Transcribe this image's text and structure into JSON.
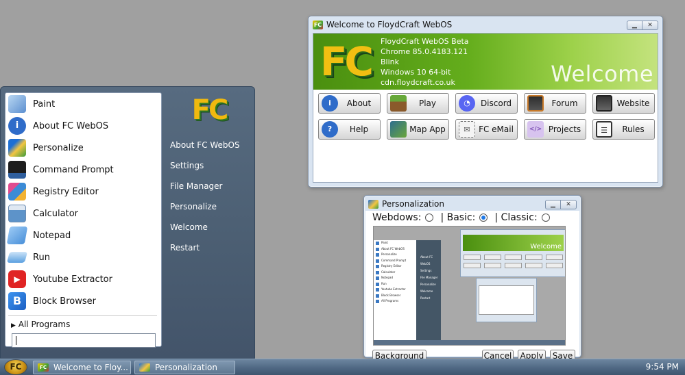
{
  "welcome_window": {
    "title": "Welcome to FloydCraft WebOS",
    "logo": "FC",
    "info": [
      "FloydCraft WebOS Beta",
      "Chrome 85.0.4183.121",
      "Blink",
      "Windows 10 64-bit",
      "cdn.floydcraft.co.uk"
    ],
    "welcome_text": "Welcome",
    "buttons": [
      {
        "label": "About",
        "icon": "info-icon",
        "color": "#2f6cc9"
      },
      {
        "label": "Play",
        "icon": "grass-block-icon",
        "color": "#5c8a2e"
      },
      {
        "label": "Discord",
        "icon": "discord-icon",
        "color": "#5865f2"
      },
      {
        "label": "Forum",
        "icon": "forum-icon",
        "color": "#2d2d2d"
      },
      {
        "label": "Website",
        "icon": "website-icon",
        "color": "#333333"
      },
      {
        "label": "Help",
        "icon": "help-icon",
        "color": "#2f6cc9"
      },
      {
        "label": "Map App",
        "icon": "map-icon",
        "color": "#2e6f8f"
      },
      {
        "label": "FC eMail",
        "icon": "email-icon",
        "color": "#777777"
      },
      {
        "label": "Projects",
        "icon": "projects-icon",
        "color": "#b38fd9"
      },
      {
        "label": "Rules",
        "icon": "rules-icon",
        "color": "#3a3a3a"
      }
    ]
  },
  "personalization_window": {
    "title": "Personalization",
    "modes": [
      {
        "label": "Webdows:",
        "selected": false
      },
      {
        "label": "| Basic:",
        "selected": true
      },
      {
        "label": "| Classic:",
        "selected": false
      }
    ],
    "preview": {
      "start_items": [
        "Paint",
        "About FC WebOS",
        "Personalize",
        "Command Prompt",
        "Registry Editor",
        "Calculator",
        "Notepad",
        "Run",
        "Youtube Extractor",
        "Block Browser",
        "All Programs"
      ],
      "right_items": [
        "About FC WebOS",
        "Settings",
        "File Manager",
        "Personalize",
        "Welcome",
        "Restart"
      ],
      "welcome_caption": "Welcome"
    },
    "buttons": {
      "background": "Background",
      "cancel": "Cancel",
      "apply": "Apply",
      "save": "Save"
    }
  },
  "start_menu": {
    "items": [
      {
        "label": "Paint",
        "icon": "paint-icon",
        "color": "#6aa0d8"
      },
      {
        "label": "About FC WebOS",
        "icon": "info-icon",
        "color": "#2f6cc9"
      },
      {
        "label": "Personalize",
        "icon": "personalize-icon",
        "color": "#2a7bd1"
      },
      {
        "label": "Command Prompt",
        "icon": "command-prompt-icon",
        "color": "#1a1a1a"
      },
      {
        "label": "Registry Editor",
        "icon": "registry-icon",
        "color": "#3c8bd6"
      },
      {
        "label": "Calculator",
        "icon": "calculator-icon",
        "color": "#5d93c9"
      },
      {
        "label": "Notepad",
        "icon": "notepad-icon",
        "color": "#4a90d9"
      },
      {
        "label": "Run",
        "icon": "run-icon",
        "color": "#5aa0e0"
      },
      {
        "label": "Youtube Extractor",
        "icon": "youtube-icon",
        "color": "#e02424"
      },
      {
        "label": "Block Browser",
        "icon": "block-browser-icon",
        "color": "#2b7de0"
      }
    ],
    "all_programs": "All Programs",
    "logo": "FC",
    "right_items": [
      "About FC WebOS",
      "Settings",
      "File Manager",
      "Personalize",
      "Welcome",
      "Restart"
    ]
  },
  "taskbar": {
    "tasks": [
      "Welcome to Floy...",
      "Personalization"
    ],
    "clock": "9:54 PM",
    "start_label": "FC"
  }
}
